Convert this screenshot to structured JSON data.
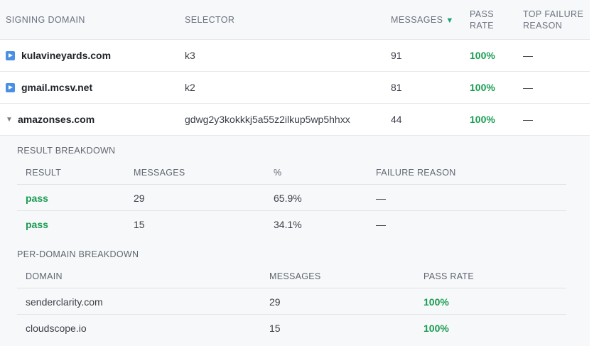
{
  "main_table": {
    "headers": {
      "signing_domain": "SIGNING DOMAIN",
      "selector": "SELECTOR",
      "messages": "MESSAGES",
      "sort_indicator": "▼",
      "pass_rate_line1": "PASS",
      "pass_rate_line2": "RATE",
      "top_failure_line1": "TOP FAILURE",
      "top_failure_line2": "REASON"
    },
    "rows": [
      {
        "domain": "kulavineyards.com",
        "selector": "k3",
        "messages": "91",
        "pass_rate": "100%",
        "top_failure": "—",
        "expanded": false
      },
      {
        "domain": "gmail.mcsv.net",
        "selector": "k2",
        "messages": "81",
        "pass_rate": "100%",
        "top_failure": "—",
        "expanded": false
      },
      {
        "domain": "amazonses.com",
        "selector": "gdwg2y3kokkkj5a55z2ilkup5wp5hhxx",
        "messages": "44",
        "pass_rate": "100%",
        "top_failure": "—",
        "expanded": true
      }
    ]
  },
  "result_breakdown": {
    "title": "RESULT BREAKDOWN",
    "headers": {
      "result": "RESULT",
      "messages": "MESSAGES",
      "percent": "%",
      "failure_reason": "FAILURE REASON"
    },
    "rows": [
      {
        "result": "pass",
        "messages": "29",
        "percent": "65.9%",
        "failure_reason": "—"
      },
      {
        "result": "pass",
        "messages": "15",
        "percent": "34.1%",
        "failure_reason": "—"
      }
    ]
  },
  "per_domain_breakdown": {
    "title": "PER-DOMAIN BREAKDOWN",
    "headers": {
      "domain": "DOMAIN",
      "messages": "MESSAGES",
      "pass_rate": "PASS RATE"
    },
    "rows": [
      {
        "domain": "senderclarity.com",
        "messages": "29",
        "pass_rate": "100%"
      },
      {
        "domain": "cloudscope.io",
        "messages": "15",
        "pass_rate": "100%"
      }
    ]
  },
  "colors": {
    "pass_green": "#1a9c52",
    "sort_accent": "#1aa37a",
    "expand_blue": "#4a90e2"
  },
  "icons": {
    "expand": "expand-triangle-icon",
    "collapse": "collapse-triangle-icon",
    "sort": "sort-descending-icon"
  }
}
